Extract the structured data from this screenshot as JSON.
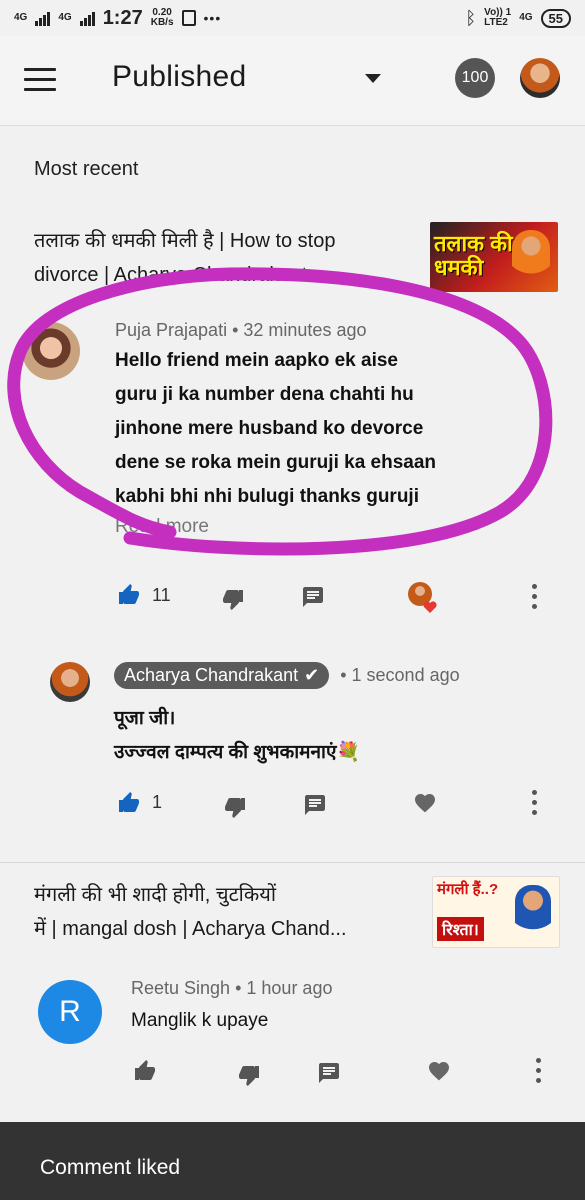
{
  "status_bar": {
    "network_left_1": "4G",
    "network_left_2": "4G",
    "time": "1:27",
    "speed_value": "0.20",
    "speed_unit": "KB/s",
    "more": "•••",
    "right_net": "Vo)) 1\nLTE2",
    "right_net_2": "4G",
    "battery": "55"
  },
  "app_bar": {
    "title": "Published",
    "count_badge": "100"
  },
  "section_label": "Most recent",
  "videos": [
    {
      "title_line1": "तलाक की धमकी मिली है | How to stop",
      "title_line2": "divorce | Acharya Chandrakant",
      "thumbnail_text": "तलाक की धमकी",
      "comments": [
        {
          "author": "Puja Prajapati",
          "time": "• 32 minutes ago",
          "text_lines": [
            "Hello friend mein aapko ek aise",
            "guru ji ka number dena chahti hu",
            "jinhone mere husband ko devorce",
            "dene se roka mein guruji ka ehsaan",
            "kabhi bhi nhi bulugi thanks guruji"
          ],
          "read_more": "Read more",
          "like_count": "11"
        },
        {
          "author": "Acharya Chandrakant",
          "time": "• 1 second ago",
          "text_line1": "पूजा जी।",
          "text_line2": "उज्ज्वल दाम्पत्य की शुभकामनाएं💐",
          "like_count": "1"
        }
      ]
    },
    {
      "title_line1": "मंगली की भी शादी होगी, चुटकियों",
      "title_line2": "में | mangal dosh | Acharya Chand...",
      "thumbnail_text_1": "मंगली हैं..?",
      "thumbnail_text_2": "रिश्ता।",
      "comments": [
        {
          "author": "Reetu Singh",
          "avatar_letter": "R",
          "time": "• 1 hour ago",
          "text": "Manglik k upaye"
        }
      ]
    }
  ],
  "snackbar": "Comment liked",
  "colors": {
    "background": "#f1f1f1",
    "like_active": "#1565c0",
    "highlight_circle": "#c42fbf",
    "avatar_reetu": "#1e88e5",
    "snackbar": "#333333"
  }
}
